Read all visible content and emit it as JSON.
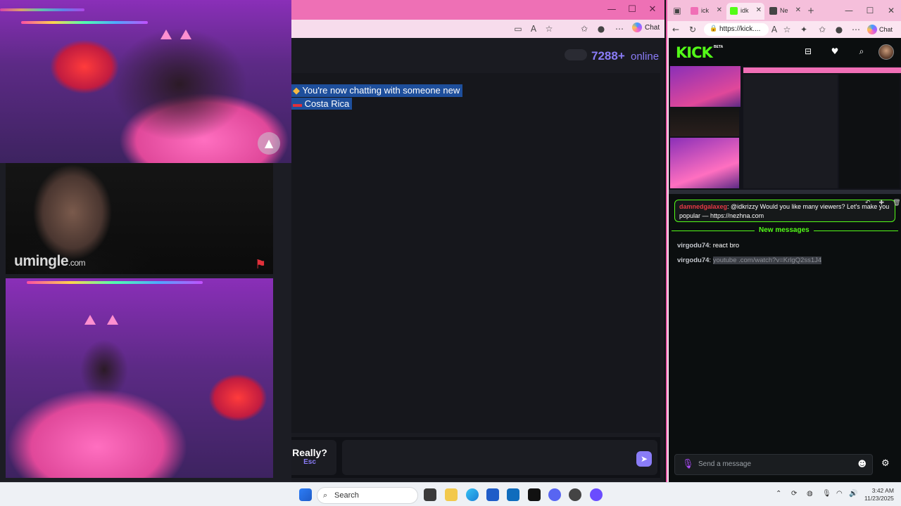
{
  "left_window": {
    "addr_chat_label": "Chat"
  },
  "stage": {
    "logo_main": "umingle",
    "logo_suffix": ".com"
  },
  "umingle": {
    "online_count": "7288+",
    "online_label": "online",
    "system_messages": [
      "You're now chatting with someone new",
      "Costa Rica"
    ],
    "really_label": "Really?",
    "esc_label": "Esc"
  },
  "right_window": {
    "tabs": [
      {
        "label": "ick",
        "favicon_color": "#f06fb6"
      },
      {
        "label": "idk",
        "favicon_color": "#53fc18"
      },
      {
        "label": "Ne",
        "favicon_color": "#444444"
      }
    ],
    "url": "https://kick...."
  },
  "kick": {
    "logo": "KICK",
    "beta": "BETA",
    "pinned": {
      "user": "damnedgalaxeg",
      "text": ": @idkrizzy Would you like many viewers? Let's make you popular — https://nezhna.com"
    },
    "new_messages_label": "New messages",
    "messages": [
      {
        "user": "virgodu74",
        "text": "react bro",
        "is_link": false
      },
      {
        "user": "virgodu74",
        "text": "youtube .com/watch?v=KrlgQ2ss1J4",
        "is_link": true
      }
    ],
    "input_placeholder": "Send a message",
    "accent_color": "#53fc18"
  },
  "taskbar": {
    "search_label": "Search",
    "time": "3:42 AM",
    "date": "11/23/2025"
  }
}
